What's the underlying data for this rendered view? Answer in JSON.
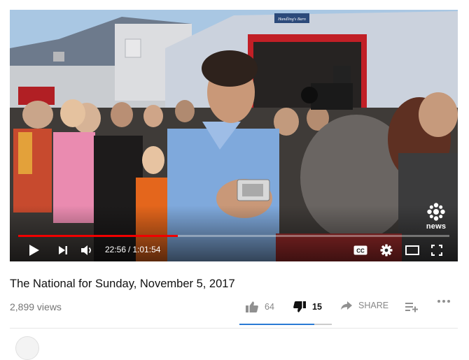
{
  "player": {
    "current_time": "22:56",
    "separator": "/",
    "duration": "1:01:54",
    "progress_fraction": 0.37,
    "cc_label": "CC",
    "watermark_label": "news",
    "scene_sign_text": "Handling's Barn"
  },
  "video": {
    "title": "The National for Sunday, November 5, 2017",
    "views": "2,899 views"
  },
  "actions": {
    "like_count": "64",
    "dislike_count": "15",
    "share_label": "SHARE",
    "sentiment_fraction": 0.81
  },
  "colors": {
    "accent_red": "#f00000",
    "sentiment_blue": "#2a7ad4",
    "muted_text": "#888888"
  },
  "icons": {
    "play": "play-icon",
    "next": "next-icon",
    "volume": "volume-icon",
    "cc": "cc-icon",
    "settings": "gear-icon",
    "theater": "theater-icon",
    "fullscreen": "fullscreen-icon",
    "like": "thumbs-up-icon",
    "dislike": "thumbs-down-icon",
    "share": "share-arrow-icon",
    "playlist": "playlist-add-icon",
    "more": "more-icon"
  }
}
